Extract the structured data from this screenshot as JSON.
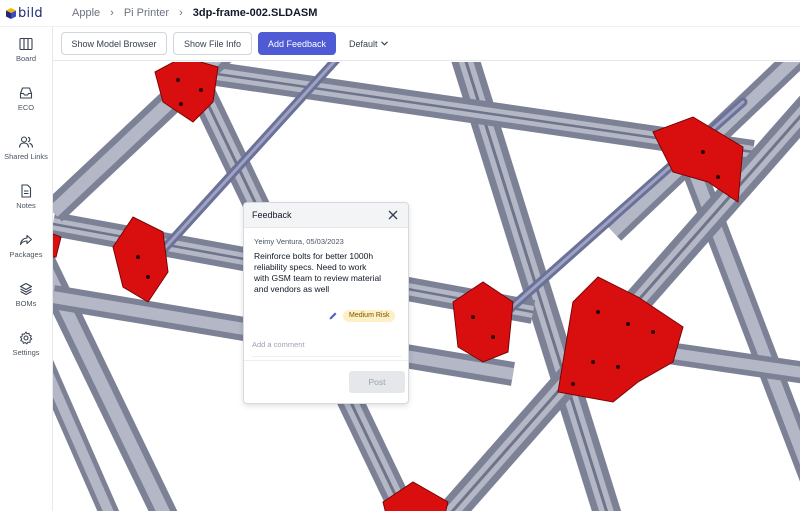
{
  "app": {
    "logo_text": "bild"
  },
  "breadcrumb": {
    "items": [
      "Apple",
      "Pi Printer"
    ],
    "current": "3dp-frame-002.SLDASM"
  },
  "sidebar": {
    "items": [
      {
        "label": "Board",
        "icon": "board-icon"
      },
      {
        "label": "ECO",
        "icon": "inbox-icon"
      },
      {
        "label": "Shared Links",
        "icon": "users-icon"
      },
      {
        "label": "Notes",
        "icon": "document-icon"
      },
      {
        "label": "Packages",
        "icon": "share-arrow-icon"
      },
      {
        "label": "BOMs",
        "icon": "layers-icon"
      },
      {
        "label": "Settings",
        "icon": "gear-icon"
      }
    ]
  },
  "toolbar": {
    "model_browser": "Show Model Browser",
    "file_info": "Show File Info",
    "add_feedback": "Add Feedback",
    "view_select": "Default"
  },
  "feedback": {
    "title": "Feedback",
    "author_date": "Yeimy Ventura, 05/03/2023",
    "comment_lines": [
      "Reinforce bolts for better 1000h",
      "reliability specs. Need to work",
      "with GSM team to review material",
      "and vendors as well"
    ],
    "risk_label": "Medium Risk",
    "comment_placeholder": "Add a comment",
    "post_label": "Post"
  },
  "colors": {
    "primary": "#4f5bd5",
    "risk_badge_bg": "#fdf0c4",
    "bracket_red": "#d90f0f",
    "rail_gray": "#8a8fa3",
    "rod_blue": "#6b7197"
  }
}
